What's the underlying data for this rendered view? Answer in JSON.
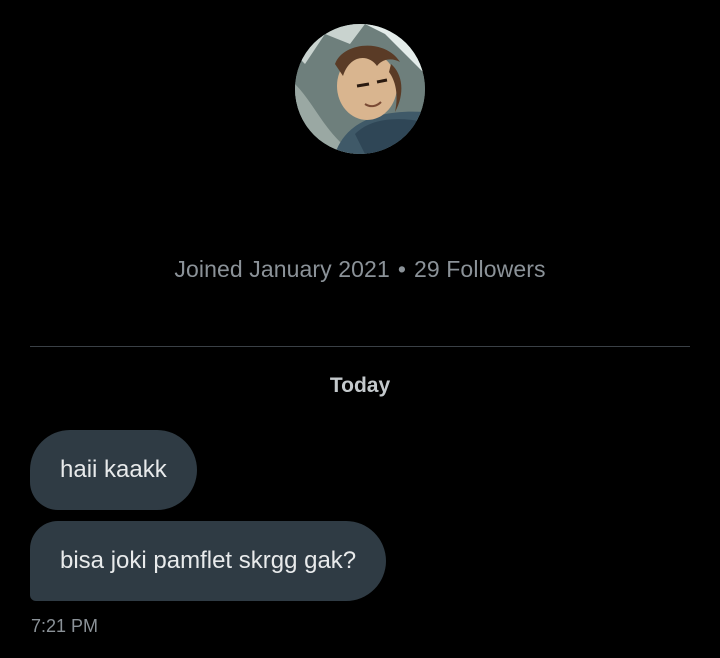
{
  "profile": {
    "joined": "Joined January 2021",
    "separator": "•",
    "followers": "29 Followers"
  },
  "conversation": {
    "date_separator": "Today",
    "messages": [
      {
        "text": "haii kaakk"
      },
      {
        "text": "bisa joki pamflet skrgg gak?"
      }
    ],
    "timestamp": "7:21 PM"
  }
}
